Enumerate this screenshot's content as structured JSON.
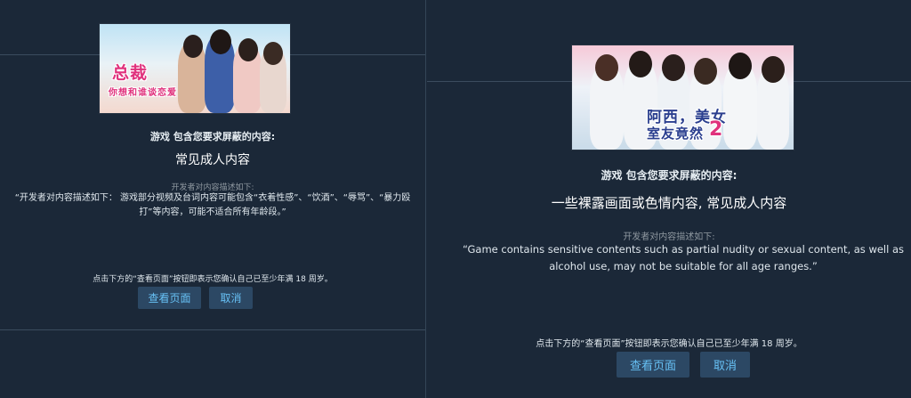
{
  "left": {
    "banner_logo_line1": "总裁",
    "banner_logo_line2": "你想和谁谈恋爱",
    "blocked_heading": "游戏 包含您要求屏蔽的内容:",
    "blocked_tags": "常见成人内容",
    "developer_desc_label": "开发者对内容描述如下:",
    "developer_desc": "“开发者对内容描述如下： 游戏部分视频及台词内容可能包含“衣着性感”、“饮酒”、“辱骂”、“暴力殴打”等内容，可能不适合所有年龄段。”",
    "confirm_notice": "点击下方的“查看页面”按钮即表示您确认自己已至少年满 18 周岁。",
    "view_page_label": "查看页面",
    "cancel_label": "取消"
  },
  "right": {
    "banner_logo_line1": "阿西，美女",
    "banner_logo_line2": "室友竟然",
    "banner_logo_number": "2",
    "blocked_heading": "游戏 包含您要求屏蔽的内容:",
    "blocked_tags": "一些裸露画面或色情内容, 常见成人内容",
    "developer_desc_label": "开发者对内容描述如下:",
    "developer_desc": "“Game contains sensitive contents such as partial nudity or sexual content, as well as alcohol use, may not be suitable for all age ranges.”",
    "confirm_notice": "点击下方的“查看页面”按钮即表示您确认自己已至少年满 18 周岁。",
    "view_page_label": "查看页面",
    "cancel_label": "取消"
  },
  "colors": {
    "background": "#1b2838",
    "button_bg": "#2c4864",
    "button_text": "#67c1f5",
    "muted_text": "#8f98a0",
    "body_text": "#c6d4df"
  }
}
